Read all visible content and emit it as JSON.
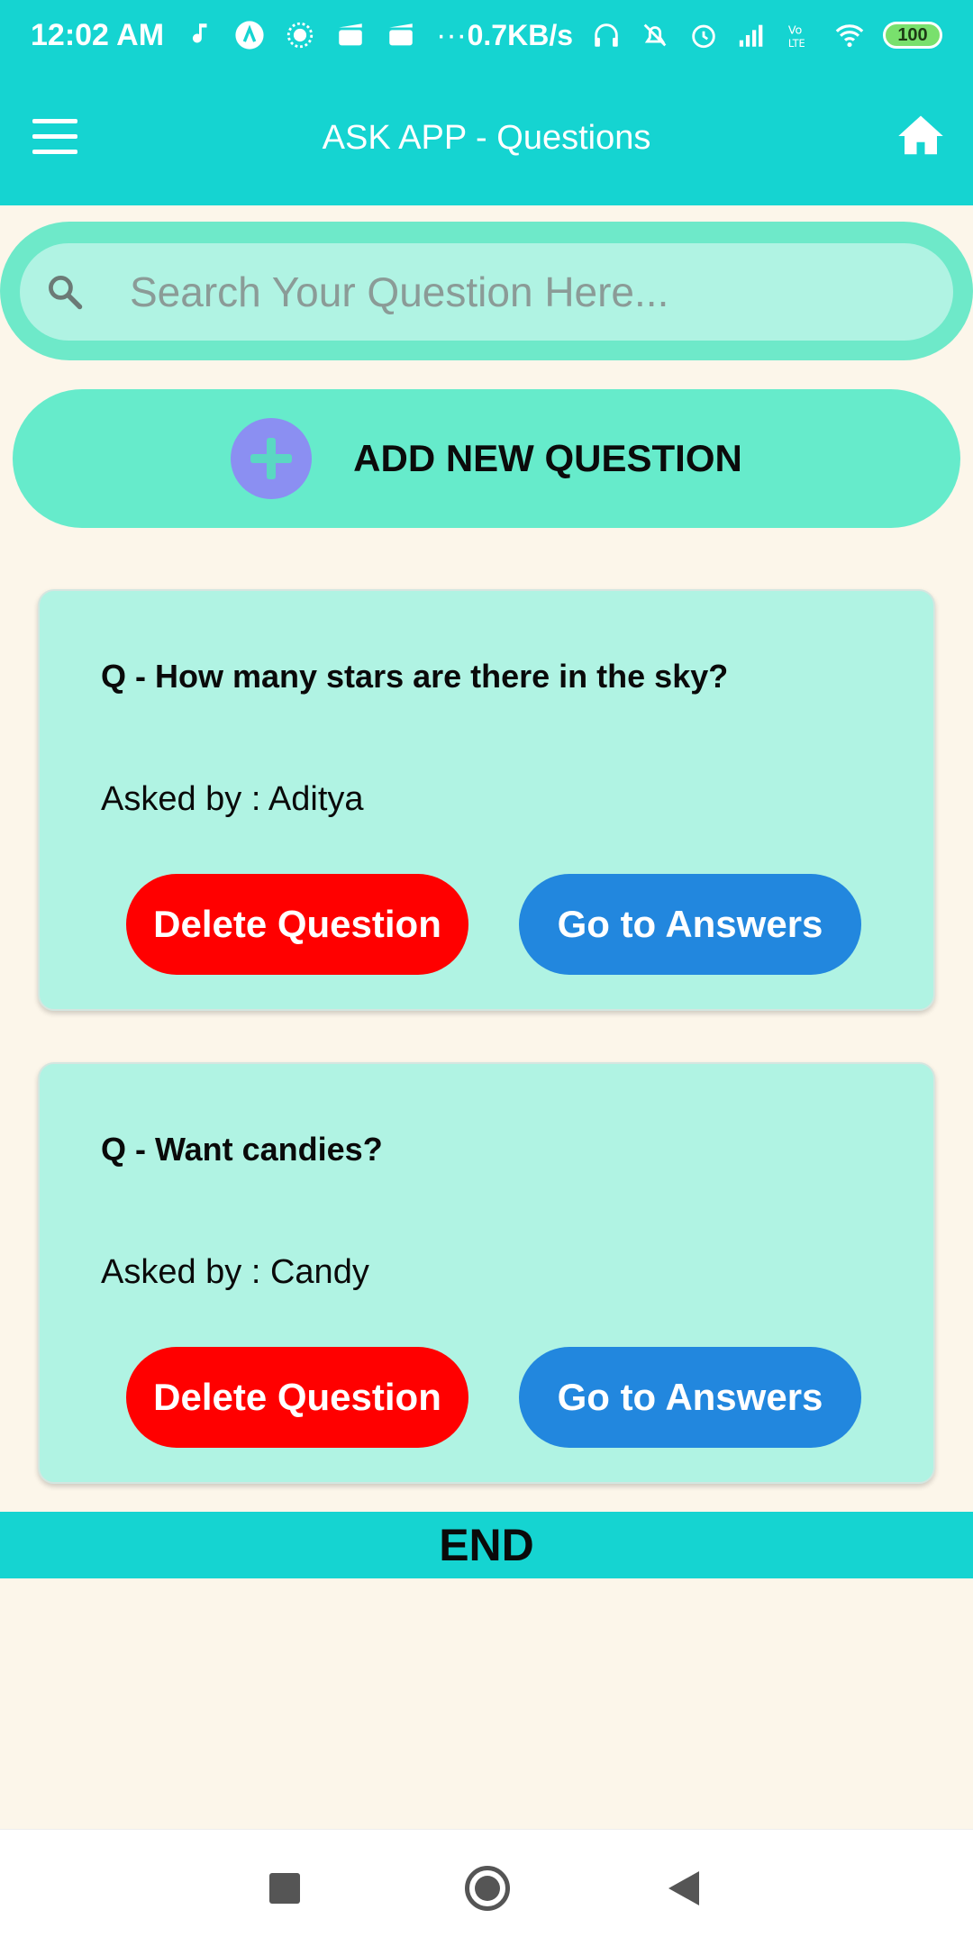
{
  "status_bar": {
    "time": "12:02 AM",
    "speed": "0.7KB/s",
    "overflow": "···",
    "battery": "100",
    "icons": [
      "music-note-icon",
      "a-badge-icon",
      "sun-icon",
      "clapper-icon",
      "clapper-icon",
      "headphones-icon",
      "alarm-off-icon",
      "alarm-icon",
      "signal-icon",
      "volte-icon",
      "wifi-icon"
    ]
  },
  "app_bar": {
    "title": "ASK APP - Questions",
    "menu_icon": "hamburger-menu-icon",
    "home_icon": "home-icon"
  },
  "search": {
    "placeholder": "Search Your Question Here...",
    "value": ""
  },
  "add_question": {
    "label": "ADD NEW QUESTION"
  },
  "questions": [
    {
      "question": "Q - How many stars are there in the sky?",
      "asked_by_label": "Asked by : ",
      "asked_by": "Aditya",
      "delete_label": "Delete Question",
      "answers_label": "Go to Answers"
    },
    {
      "question": "Q - Want candies?",
      "asked_by_label": "Asked by : ",
      "asked_by": "Candy",
      "delete_label": "Delete Question",
      "answers_label": "Go to Answers"
    }
  ],
  "end_label": "END",
  "colors": {
    "header": "#15d4d1",
    "background": "#fcf6ea",
    "card": "#b0f3e3",
    "add_button": "#66ebcb",
    "delete": "#ff0000",
    "answers": "#2287de"
  }
}
